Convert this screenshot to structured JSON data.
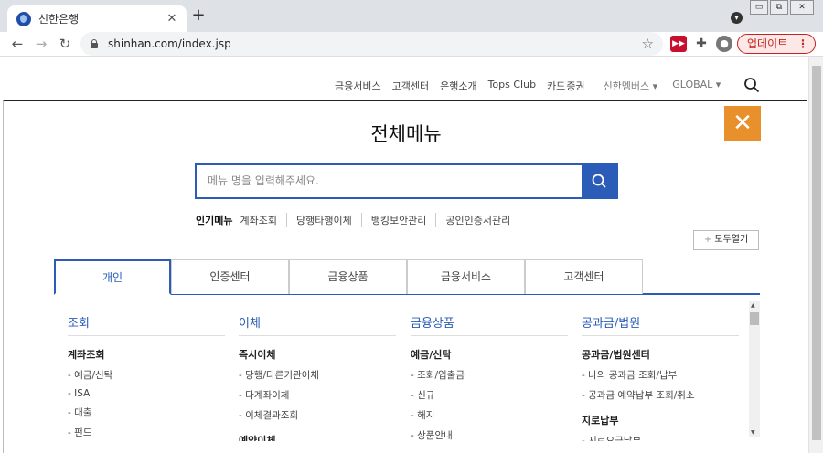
{
  "browser": {
    "tab_title": "신한은행",
    "tab_close": "✕",
    "new_tab": "+",
    "url": "shinhan.com/index.jsp",
    "update_label": "업데이트",
    "update_menu": "⋮",
    "window_controls": [
      "▭",
      "⧉",
      "✕"
    ]
  },
  "header": {
    "nav": [
      "금융서비스",
      "고객센터",
      "은행소개",
      "Tops Club",
      "카드",
      "증권",
      "신한멤버스 ▾",
      "GLOBAL ▾"
    ],
    "annotation_color": "#e02020"
  },
  "panel": {
    "title": "전체메뉴",
    "close": "✕",
    "search_placeholder": "메뉴 명을 입력해주세요.",
    "popular_label": "인기메뉴",
    "popular_items": [
      "계좌조회",
      "당행타행이체",
      "뱅킹보안관리",
      "공인인증서관리"
    ],
    "expand_all": "모두열기",
    "tabs": [
      "개인",
      "인증센터",
      "금융상품",
      "금융서비스",
      "고객센터"
    ],
    "active_tab": 0,
    "columns": [
      {
        "heading": "조회",
        "groups": [
          {
            "title": "계좌조회",
            "items": [
              "예금/신탁",
              "ISA",
              "대출",
              "펀드"
            ]
          }
        ]
      },
      {
        "heading": "이체",
        "groups": [
          {
            "title": "즉시이체",
            "items": [
              "당행/다른기관이체",
              "다계좌이체",
              "이체결과조회"
            ]
          },
          {
            "title": "예약이체",
            "items": []
          }
        ]
      },
      {
        "heading": "금융상품",
        "groups": [
          {
            "title": "예금/신탁",
            "items": [
              "조회/입출금",
              "신규",
              "해지",
              "상품안내"
            ]
          }
        ]
      },
      {
        "heading": "공과금/법원",
        "groups": [
          {
            "title": "공과금/법원센터",
            "items": [
              "나의 공과금 조회/납부",
              "공과금 예약납부 조회/취소"
            ]
          },
          {
            "title": "지로납부",
            "items": [
              "지로요금납부"
            ]
          }
        ]
      }
    ]
  },
  "colors": {
    "brand_blue": "#2a5cb8",
    "close_orange": "#e8902c",
    "update_red": "#c5221f"
  }
}
